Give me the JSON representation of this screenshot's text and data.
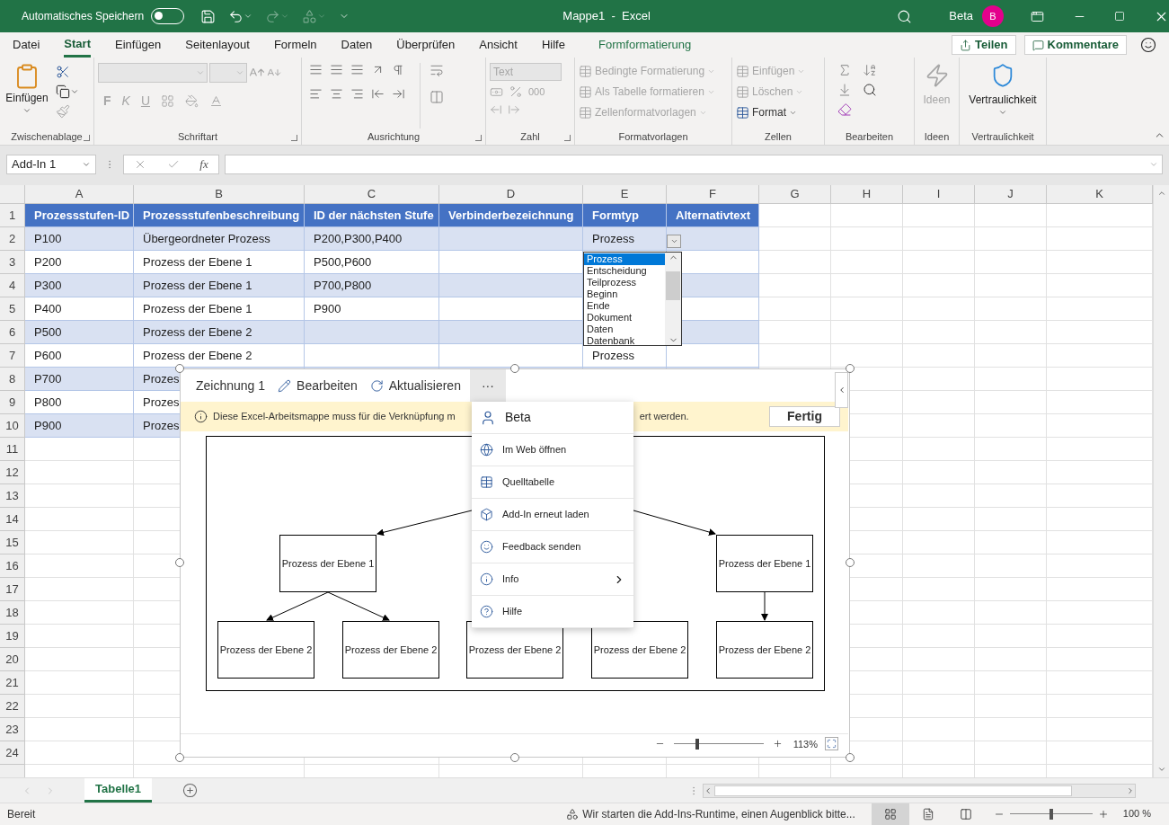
{
  "title_bar": {
    "autosave": {
      "label": "Automatisches Speichern",
      "on": false
    },
    "title": "Mappe1  -  Excel",
    "user": "Beta",
    "avatar": "B"
  },
  "tabs": [
    {
      "label": "Datei",
      "selected": false,
      "kind": "normal"
    },
    {
      "label": "Start",
      "selected": true,
      "kind": "normal"
    },
    {
      "label": "Einfügen",
      "selected": false,
      "kind": "normal"
    },
    {
      "label": "Seitenlayout",
      "selected": false,
      "kind": "normal"
    },
    {
      "label": "Formeln",
      "selected": false,
      "kind": "normal"
    },
    {
      "label": "Daten",
      "selected": false,
      "kind": "normal"
    },
    {
      "label": "Überprüfen",
      "selected": false,
      "kind": "normal"
    },
    {
      "label": "Ansicht",
      "selected": false,
      "kind": "normal"
    },
    {
      "label": "Hilfe",
      "selected": false,
      "kind": "normal"
    },
    {
      "label": "Formformatierung",
      "selected": false,
      "kind": "contextual"
    }
  ],
  "share_button": "Teilen",
  "comments_button": "Kommentare",
  "ribbon": {
    "groups": [
      {
        "label": "Zwischenablage",
        "launcher": true
      },
      {
        "label": "Schriftart",
        "launcher": true
      },
      {
        "label": "Ausrichtung",
        "launcher": true
      },
      {
        "label": "Zahl",
        "launcher": true
      },
      {
        "label": "Formatvorlagen",
        "launcher": false
      },
      {
        "label": "Zellen",
        "launcher": false
      },
      {
        "label": "Bearbeiten",
        "launcher": false
      },
      {
        "label": "Ideen",
        "launcher": false
      },
      {
        "label": "Vertraulichkeit",
        "launcher": false
      }
    ],
    "paste": "Einfügen",
    "font_styles": [
      "F",
      "K",
      "U"
    ],
    "number_format": "Text",
    "thousands": "000",
    "styles": [
      {
        "label": "Bedingte Formatierung",
        "disabled": true
      },
      {
        "label": "Als Tabelle formatieren",
        "disabled": true
      },
      {
        "label": "Zellenformatvorlagen",
        "disabled": true
      }
    ],
    "cells": [
      {
        "label": "Einfügen",
        "disabled": true
      },
      {
        "label": "Löschen",
        "disabled": true
      },
      {
        "label": "Format",
        "disabled": false
      }
    ],
    "ideas": {
      "label": "Ideen",
      "disabled": true
    },
    "sensitivity": "Vertraulichkeit"
  },
  "formula_bar": {
    "name_box": "Add-In 1",
    "fx": "fx"
  },
  "sheet": {
    "columns": [
      "A",
      "B",
      "C",
      "D",
      "E",
      "F",
      "G",
      "H",
      "I",
      "J",
      "K"
    ],
    "row_numbers": [
      "1",
      "2",
      "3",
      "4",
      "5",
      "6",
      "7",
      "8",
      "9",
      "10",
      "11",
      "12",
      "13",
      "14",
      "15",
      "16",
      "17",
      "18",
      "19",
      "20",
      "21",
      "22",
      "23",
      "24"
    ],
    "rows": [
      {
        "kind": "header",
        "cells": [
          "Prozessstufen-ID",
          "Prozessstufenbeschreibung",
          "ID der nächsten Stufe",
          "Verbinderbezeichnung",
          "Formtyp",
          "Alternativtext"
        ]
      },
      {
        "kind": "shaded",
        "cells": [
          "P100",
          "Übergeordneter Prozess",
          "P200,P300,P400",
          null,
          "Prozess"
        ]
      },
      {
        "kind": "plain",
        "cells": [
          "P200",
          "Prozess der Ebene 1",
          "P500,P600"
        ]
      },
      {
        "kind": "shaded",
        "cells": [
          "P300",
          "Prozess der Ebene 1",
          "P700,P800"
        ]
      },
      {
        "kind": "plain",
        "cells": [
          "P400",
          "Prozess der Ebene 1",
          "P900"
        ]
      },
      {
        "kind": "shaded",
        "cells": [
          "P500",
          "Prozess der Ebene 2"
        ]
      },
      {
        "kind": "plain",
        "cells": [
          "P600",
          "Prozess der Ebene 2",
          null,
          null,
          "Prozess"
        ]
      },
      {
        "kind": "shaded",
        "cells": [
          "P700",
          "Prozes"
        ]
      },
      {
        "kind": "plain",
        "cells": [
          "P800",
          "Prozes"
        ]
      },
      {
        "kind": "shaded",
        "cells": [
          "P900",
          "Prozes"
        ]
      }
    ]
  },
  "dropdown": {
    "items": [
      {
        "label": "Prozess",
        "selected": true
      },
      {
        "label": "Entscheidung",
        "selected": false
      },
      {
        "label": "Teilprozess",
        "selected": false
      },
      {
        "label": "Beginn",
        "selected": false
      },
      {
        "label": "Ende",
        "selected": false
      },
      {
        "label": "Dokument",
        "selected": false
      },
      {
        "label": "Daten",
        "selected": false
      },
      {
        "label": "Datenbank",
        "selected": false
      }
    ]
  },
  "addin": {
    "title": "Zeichnung 1",
    "edit": "Bearbeiten",
    "refresh": "Aktualisieren",
    "more": {
      "label": "···",
      "active": true
    },
    "message": {
      "before": "Diese Excel-Arbeitsmappe muss für die Verknüpfung m",
      "after": "ert werden.",
      "button": "Fertig"
    },
    "menu": [
      {
        "kind": "account",
        "label": "Beta",
        "submenu": false
      },
      {
        "kind": "web",
        "label": "Im Web öffnen",
        "submenu": false
      },
      {
        "kind": "table",
        "label": "Quelltabelle",
        "submenu": false
      },
      {
        "kind": "reload",
        "label": "Add-In erneut laden",
        "submenu": false
      },
      {
        "kind": "feedback",
        "label": "Feedback senden",
        "submenu": false
      },
      {
        "kind": "info",
        "label": "Info",
        "submenu": true
      },
      {
        "kind": "help",
        "label": "Hilfe",
        "submenu": false
      }
    ],
    "diagram": {
      "nodes": [
        "Prozess der Ebene 1",
        "Prozess der Ebene 1",
        "Prozess der Ebene 2",
        "Prozess der Ebene 2",
        "Prozess der Ebene 2",
        "Prozess der Ebene 2",
        "Prozess der Ebene 2"
      ]
    },
    "zoom": {
      "level": 0.26,
      "reading": "113%"
    }
  },
  "sheet_tabs": [
    {
      "label": "Tabelle1",
      "selected": true
    }
  ],
  "status_bar": {
    "ready": "Bereit",
    "message": "Wir starten die Add-Ins-Runtime, einen Augenblick bitte...",
    "views": [
      {
        "selected": true
      },
      {
        "selected": false
      },
      {
        "selected": false
      }
    ],
    "zoom": {
      "level": 0.5,
      "reading": "100 %"
    }
  }
}
